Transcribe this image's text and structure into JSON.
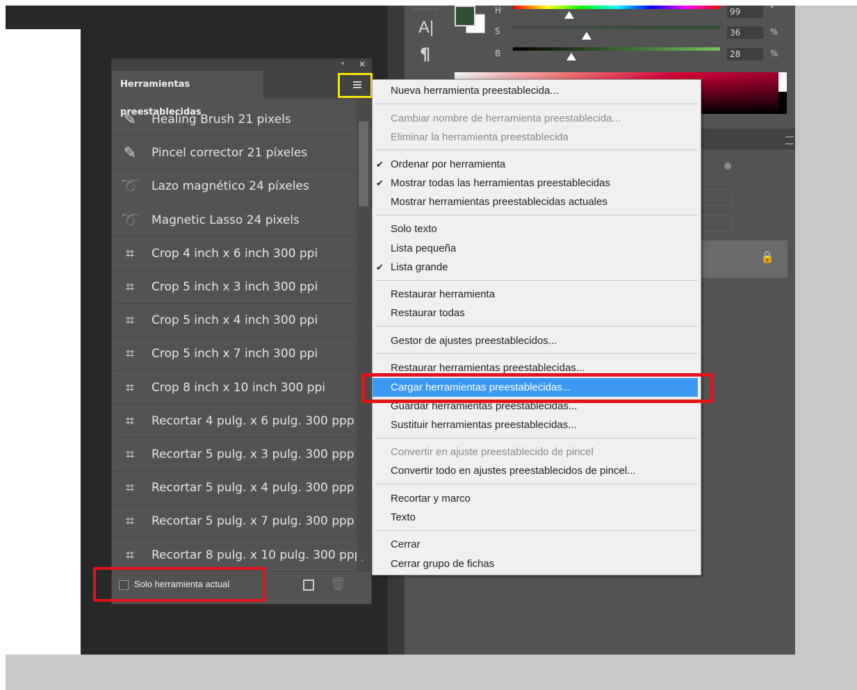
{
  "color_panel": {
    "sliders": [
      {
        "label": "H",
        "value": "99",
        "unit": "°"
      },
      {
        "label": "S",
        "value": "36",
        "unit": "%"
      },
      {
        "label": "B",
        "value": "28",
        "unit": "%"
      }
    ],
    "foreground_color": "#2f4f31",
    "background_color": "#ffffff"
  },
  "tools": {
    "text_tool_icon": "A|",
    "paragraph_icon": "¶"
  },
  "presets_panel": {
    "tab_title": "Herramientas preestablecidas",
    "items": [
      {
        "label": "Healing Brush 21 pixels",
        "icon": "healing-brush-icon"
      },
      {
        "label": "Pincel corrector 21 píxeles",
        "icon": "healing-brush-icon"
      },
      {
        "label": "Lazo magnético 24 píxeles",
        "icon": "magnetic-lasso-icon"
      },
      {
        "label": "Magnetic Lasso 24 pixels",
        "icon": "magnetic-lasso-icon"
      },
      {
        "label": "Crop 4 inch x 6 inch 300 ppi",
        "icon": "crop-icon"
      },
      {
        "label": "Crop 5 inch x 3 inch 300 ppi",
        "icon": "crop-icon"
      },
      {
        "label": "Crop 5 inch x 4 inch 300 ppi",
        "icon": "crop-icon"
      },
      {
        "label": "Crop 5 inch x 7 inch 300 ppi",
        "icon": "crop-icon"
      },
      {
        "label": "Crop 8 inch x 10 inch 300 ppi",
        "icon": "crop-icon"
      },
      {
        "label": "Recortar 4 pulg. x 6 pulg. 300 ppp",
        "icon": "crop-icon"
      },
      {
        "label": "Recortar 5 pulg. x 3 pulg. 300 ppp",
        "icon": "crop-icon"
      },
      {
        "label": "Recortar 5 pulg. x 4 pulg. 300 ppp",
        "icon": "crop-icon"
      },
      {
        "label": "Recortar 5 pulg. x 7 pulg. 300 ppp",
        "icon": "crop-icon"
      },
      {
        "label": "Recortar 8 pulg. x 10 pulg. 300 ppp",
        "icon": "crop-icon"
      }
    ],
    "footer": {
      "checkbox_label": "Solo herramienta actual",
      "checkbox_checked": false
    }
  },
  "context_menu": {
    "items": [
      {
        "label": "Nueva herramienta preestablecida...",
        "enabled": true,
        "checked": false
      },
      {
        "label": "Cambiar nombre de herramienta preestablecida...",
        "enabled": false,
        "checked": false
      },
      {
        "label": "Eliminar la herramienta preestablecida",
        "enabled": false,
        "checked": false
      },
      {
        "label": "Ordenar por herramienta",
        "enabled": true,
        "checked": true
      },
      {
        "label": "Mostrar todas las herramientas preestablecidas",
        "enabled": true,
        "checked": true
      },
      {
        "label": "Mostrar herramientas preestablecidas actuales",
        "enabled": true,
        "checked": false
      },
      {
        "label": "Solo texto",
        "enabled": true,
        "checked": false
      },
      {
        "label": "Lista pequeña",
        "enabled": true,
        "checked": false
      },
      {
        "label": "Lista grande",
        "enabled": true,
        "checked": true
      },
      {
        "label": "Restaurar herramienta",
        "enabled": true,
        "checked": false
      },
      {
        "label": "Restaurar todas",
        "enabled": true,
        "checked": false
      },
      {
        "label": "Gestor de ajustes preestablecidos...",
        "enabled": true,
        "checked": false
      },
      {
        "label": "Restaurar herramientas preestablecidas...",
        "enabled": true,
        "checked": false
      },
      {
        "label": "Cargar herramientas preestablecidas...",
        "enabled": true,
        "checked": false,
        "highlighted": true
      },
      {
        "label": "Guardar herramientas preestablecidas...",
        "enabled": true,
        "checked": false
      },
      {
        "label": "Sustituir herramientas preestablecidas...",
        "enabled": true,
        "checked": false
      },
      {
        "label": "Convertir en ajuste preestablecido de pincel",
        "enabled": false,
        "checked": false
      },
      {
        "label": "Convertir todo en ajustes preestablecidos de pincel...",
        "enabled": true,
        "checked": false
      },
      {
        "label": "Recortar y marco",
        "enabled": true,
        "checked": false
      },
      {
        "label": "Texto",
        "enabled": true,
        "checked": false
      },
      {
        "label": "Cerrar",
        "enabled": true,
        "checked": false
      },
      {
        "label": "Cerrar grupo de fichas",
        "enabled": true,
        "checked": false
      }
    ],
    "check_glyph": "✔"
  },
  "annotation_colors": {
    "yellow": "#f5e400",
    "red": "#e3131b",
    "highlight": "#3c98f0"
  }
}
